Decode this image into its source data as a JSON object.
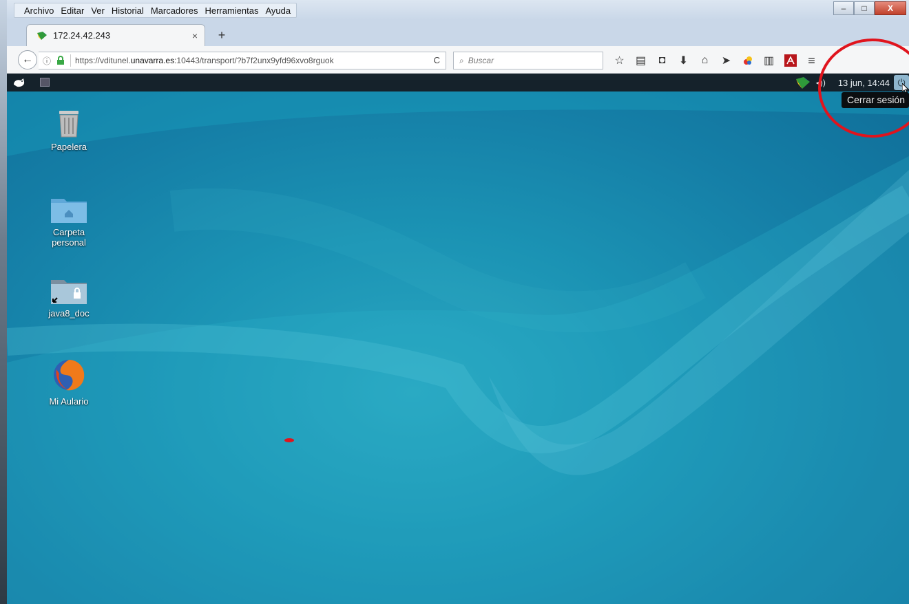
{
  "menu": [
    "Archivo",
    "Editar",
    "Ver",
    "Historial",
    "Marcadores",
    "Herramientas",
    "Ayuda"
  ],
  "window": {
    "min": "–",
    "max": "□",
    "close": "X"
  },
  "tab": {
    "title": "172.24.42.243",
    "close": "×",
    "new": "+"
  },
  "nav": {
    "back": "←",
    "url_prefix": "https://vditunel.",
    "url_strong": "unavarra.es",
    "url_suffix": ":10443/transport/?b7f2unx9yfd96xvo8rguok",
    "reload": "C",
    "search_placeholder": "Buscar",
    "toolbar_icons": [
      "bookmark-star-icon",
      "reading-list-icon",
      "pocket-icon",
      "download-icon",
      "home-icon",
      "send-icon",
      "extension-icon",
      "clipboard-icon",
      "pdf-icon",
      "menu-icon"
    ]
  },
  "desktop": {
    "clock": "13 jun, 14:44",
    "tooltip": "Cerrar sesión",
    "volume": "◂))",
    "icons": [
      {
        "label": "Papelera",
        "icon": "trash-icon"
      },
      {
        "label": "Carpeta\npersonal",
        "icon": "home-folder-icon"
      },
      {
        "label": "java8_doc",
        "icon": "shared-folder-icon"
      },
      {
        "label": "Mi Aulario",
        "icon": "firefox-icon"
      }
    ]
  },
  "colors": {
    "annotation": "#e0141d",
    "panel": "#15222b",
    "desktop": "#1b93b4"
  }
}
